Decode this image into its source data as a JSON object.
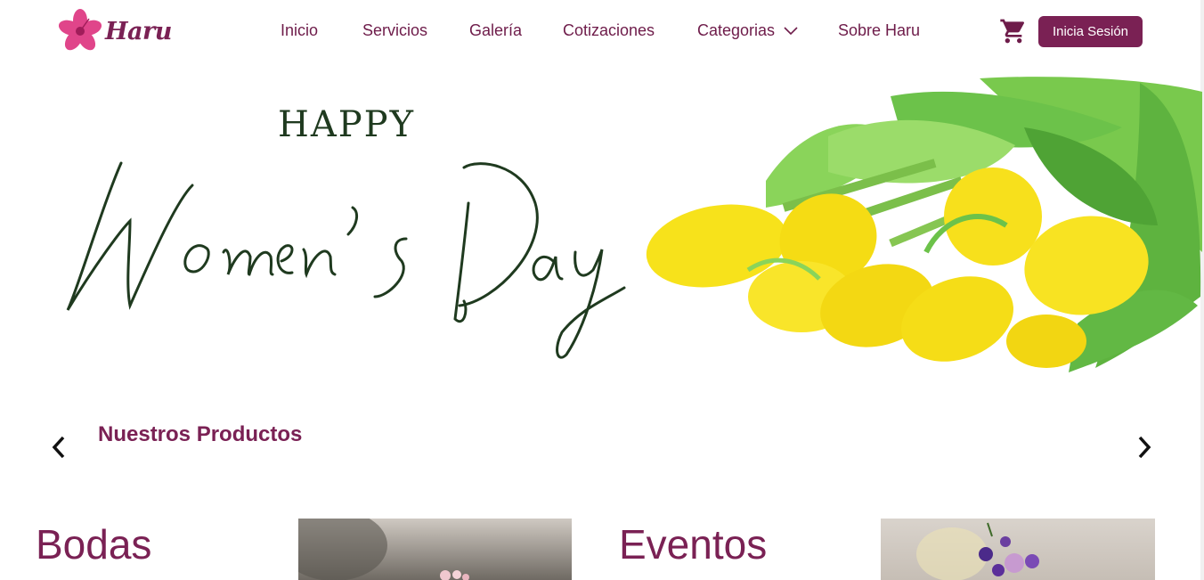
{
  "brand": {
    "name": "Haru"
  },
  "nav": {
    "items": [
      {
        "label": "Inicio"
      },
      {
        "label": "Servicios"
      },
      {
        "label": "Galería"
      },
      {
        "label": "Cotizaciones"
      },
      {
        "label": "Categorias"
      },
      {
        "label": "Sobre Haru"
      }
    ],
    "login_label": "Inicia Sesión",
    "cart_icon": "shopping-cart-icon",
    "dropdown_icon": "chevron-down-icon"
  },
  "hero": {
    "happy_text": "HAPPY",
    "script_text": "Women's Day"
  },
  "products": {
    "title": "Nuestros Productos",
    "prev_icon": "chevron-left-icon",
    "next_icon": "chevron-right-icon",
    "cards": [
      {
        "title": "Bodas"
      },
      {
        "title": "Eventos"
      }
    ]
  },
  "colors": {
    "brand": "#7a2154",
    "hero_text": "#1f3a1f",
    "tulip_yellow": "#f7e21b",
    "leaf_green": "#6cc24a"
  }
}
